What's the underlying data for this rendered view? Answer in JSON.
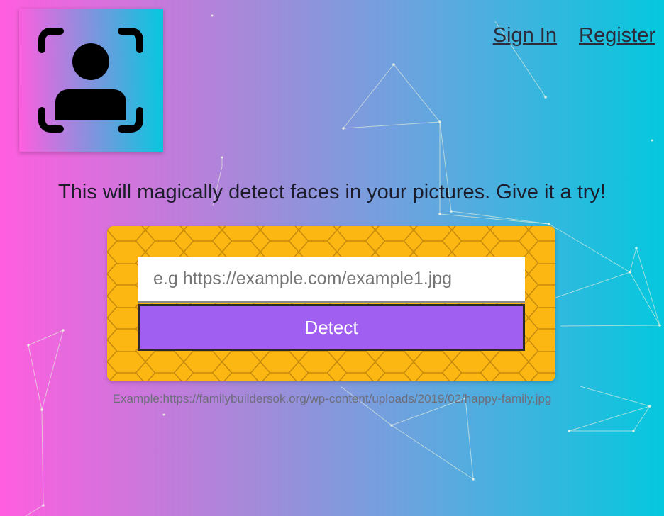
{
  "logo": {
    "icon": "face-detect-icon",
    "colors": {
      "gradient_start": "#ff5edf",
      "gradient_end": "#04c8de"
    }
  },
  "nav": {
    "sign_in": "Sign In",
    "register": "Register"
  },
  "tagline": "This will magically detect faces in your pictures. Give it a try!",
  "form": {
    "input_placeholder": "e.g https://example.com/example1.jpg",
    "input_value": "",
    "detect_label": "Detect"
  },
  "example_text": "Example:https://familybuildersok.org/wp-content/uploads/2019/02/happy-family.jpg",
  "colors": {
    "background_left": "#ff5edf",
    "background_right": "#04c8de",
    "card": "#fdb713",
    "button": "#a05ff0"
  }
}
